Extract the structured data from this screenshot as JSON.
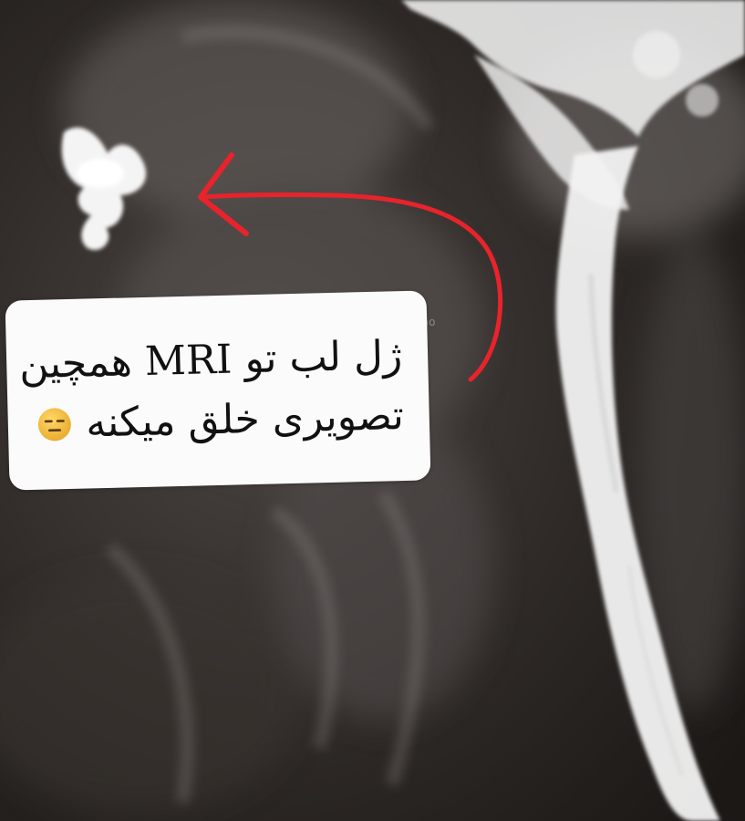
{
  "photo": {
    "subject": "mri-scan-photo",
    "colors": {
      "background": "#2a2522",
      "tissue_light": "#efefef",
      "arrow": "#e8232b",
      "card": "#fbfbfb",
      "text": "#111111",
      "emoji_face": "#f6c643"
    }
  },
  "caption": {
    "line1": "ژل لب تو MRI همچین",
    "line2": "تصویری خلق میکنه",
    "emoji": "expressionless-face-emoji"
  },
  "watermark": {
    "text": "Omo"
  }
}
